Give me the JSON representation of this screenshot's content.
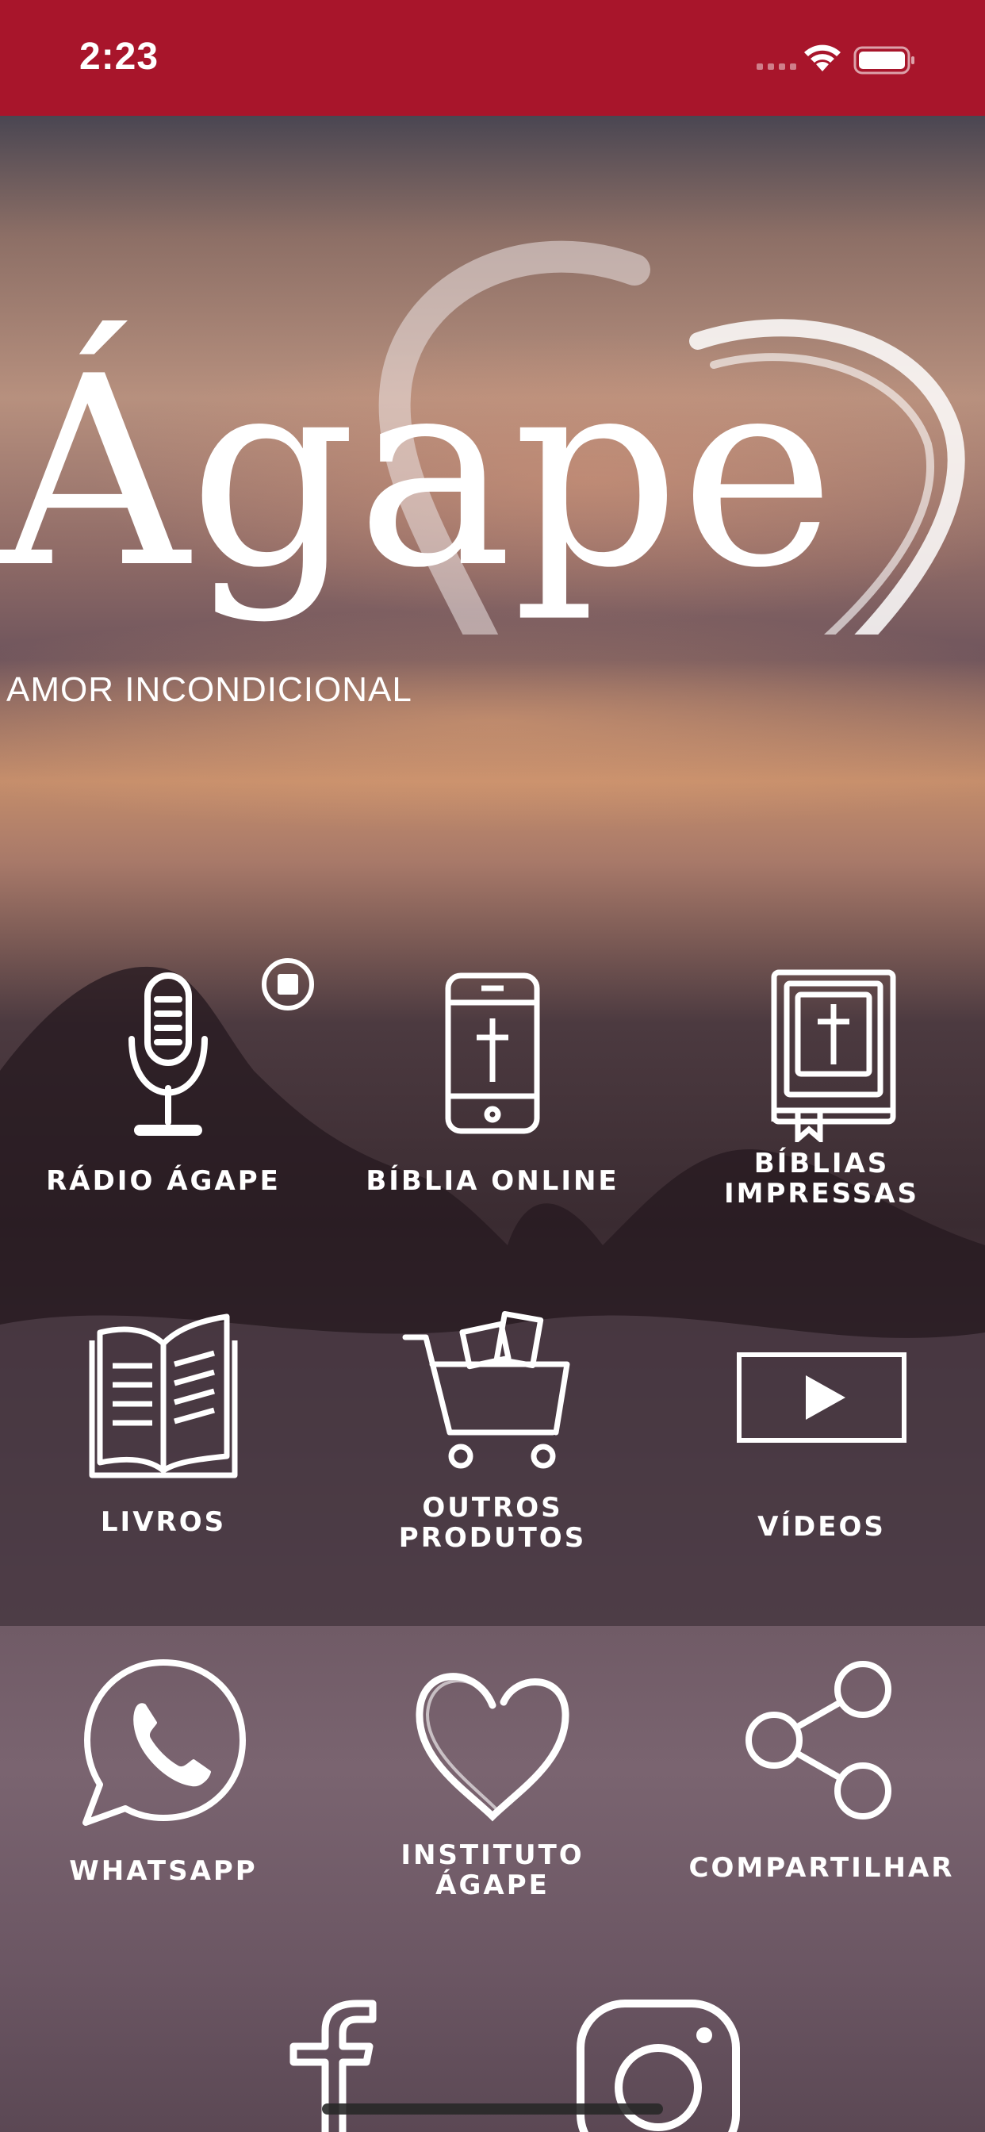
{
  "status_bar": {
    "time": "2:23",
    "background": "#a8152b"
  },
  "logo": {
    "wordmark": "Ágape",
    "tagline": "AMOR INCONDICIONAL"
  },
  "menu": [
    {
      "id": "radio",
      "label": "RÁDIO ÁGAPE",
      "icon": "microphone-icon",
      "badge": "stop-icon"
    },
    {
      "id": "biblia-online",
      "label": "BÍBLIA ONLINE",
      "icon": "phone-cross-icon"
    },
    {
      "id": "biblias-impressas",
      "label": "BÍBLIAS\nIMPRESSAS",
      "icon": "bible-book-icon"
    },
    {
      "id": "livros",
      "label": "LIVROS",
      "icon": "open-book-icon"
    },
    {
      "id": "outros-produtos",
      "label": "OUTROS\nPRODUTOS",
      "icon": "shopping-cart-icon"
    },
    {
      "id": "videos",
      "label": "VÍDEOS",
      "icon": "play-video-icon"
    },
    {
      "id": "whatsapp",
      "label": "WHATSAPP",
      "icon": "whatsapp-icon"
    },
    {
      "id": "instituto",
      "label": "INSTITUTO\nÁGAPE",
      "icon": "heart-icon"
    },
    {
      "id": "compartilhar",
      "label": "COMPARTILHAR",
      "icon": "share-icon"
    }
  ],
  "social": [
    {
      "id": "facebook",
      "icon": "facebook-icon"
    },
    {
      "id": "instagram",
      "icon": "instagram-icon"
    }
  ]
}
